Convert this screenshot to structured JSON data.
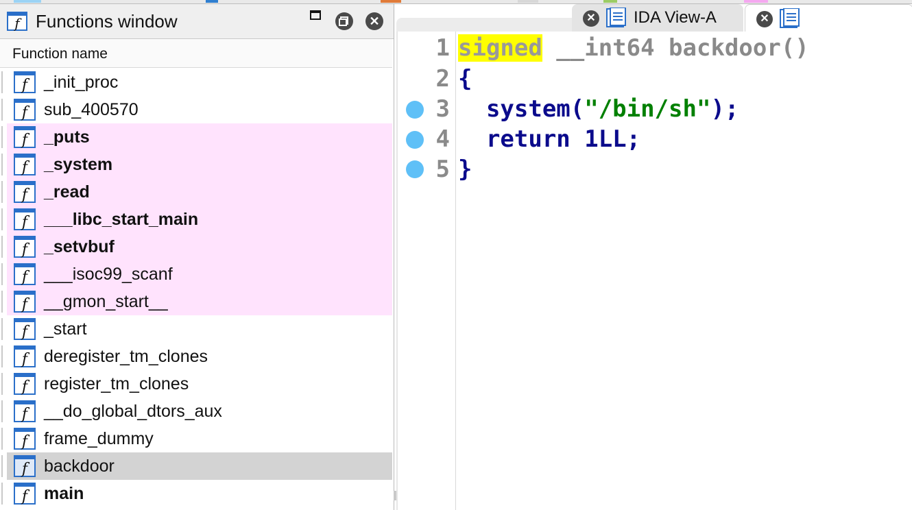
{
  "functions_window": {
    "title": "Functions window",
    "column_header": "Function name",
    "items": [
      {
        "name": "_init_proc",
        "style": "normal"
      },
      {
        "name": "sub_400570",
        "style": "normal"
      },
      {
        "name": "_puts",
        "style": "library-bold"
      },
      {
        "name": "_system",
        "style": "library-bold"
      },
      {
        "name": "_read",
        "style": "library-bold"
      },
      {
        "name": "___libc_start_main",
        "style": "library-bold"
      },
      {
        "name": "_setvbuf",
        "style": "library-bold"
      },
      {
        "name": "___isoc99_scanf",
        "style": "library"
      },
      {
        "name": "__gmon_start__",
        "style": "library"
      },
      {
        "name": "_start",
        "style": "normal"
      },
      {
        "name": "deregister_tm_clones",
        "style": "normal"
      },
      {
        "name": "register_tm_clones",
        "style": "normal"
      },
      {
        "name": "__do_global_dtors_aux",
        "style": "normal"
      },
      {
        "name": "frame_dummy",
        "style": "normal"
      },
      {
        "name": "backdoor",
        "style": "selected"
      },
      {
        "name": "main",
        "style": "bold"
      }
    ]
  },
  "tabs": [
    {
      "label": "IDA View-A",
      "active": false
    },
    {
      "label": "",
      "active": true
    }
  ],
  "pseudocode": {
    "lines": [
      {
        "num": "1",
        "parts": [
          "signed",
          " __int64 backdoor()"
        ],
        "breakpoint": false
      },
      {
        "num": "2",
        "parts": [
          "{"
        ],
        "breakpoint": false
      },
      {
        "num": "3",
        "parts": [
          "  system(",
          "\"/bin/sh\"",
          ");"
        ],
        "breakpoint": true
      },
      {
        "num": "4",
        "parts": [
          "  return 1LL;"
        ],
        "breakpoint": true
      },
      {
        "num": "5",
        "parts": [
          "}"
        ],
        "breakpoint": true
      }
    ]
  },
  "colors": {
    "library_row": "#ffe3fd",
    "selected_row": "#d3d3d3",
    "highlight": "#ffff00",
    "keyword_blue": "#0b0b8c",
    "string_green": "#008000",
    "breakpoint": "#5fc0f7"
  }
}
